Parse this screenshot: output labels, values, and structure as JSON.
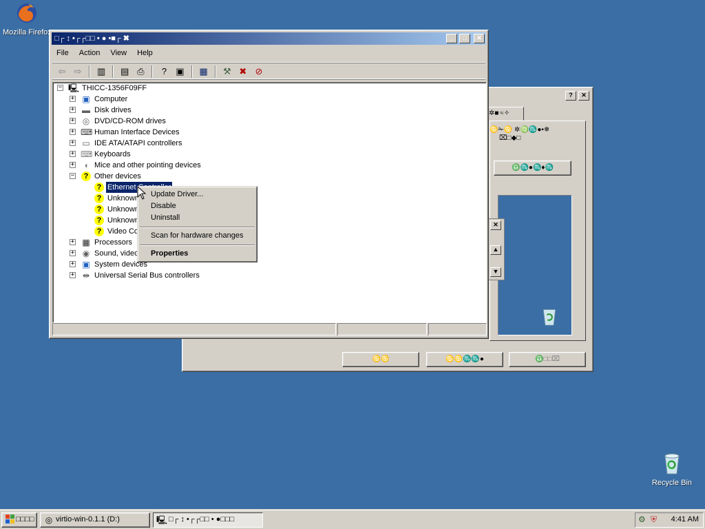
{
  "desktop": {
    "icons": [
      {
        "label": "Mozilla Firefox",
        "icon": "firefox-icon"
      },
      {
        "label": "Recycle Bin",
        "icon": "recycle-bin-icon"
      }
    ]
  },
  "background_dialog": {
    "title": "",
    "tab_label": "✲■♃✧",
    "row1": "♋✁♋ ✲♍♏●▪❄",
    "row2": "⌧□◆□",
    "button1": "♎♏●♏♦♏",
    "btn_ok": "♋♋",
    "btn_cancel": "♋♋♏♏●",
    "btn_apply": "♎□□⌧"
  },
  "device_manager": {
    "title": "□┌ ↕ •┌┌□□ • ● •■┌ ✖",
    "menu": [
      "File",
      "Action",
      "View",
      "Help"
    ],
    "tree": {
      "root": "THICC-1356F09FF",
      "categories": [
        {
          "label": "Computer",
          "icon": "computer-icon"
        },
        {
          "label": "Disk drives",
          "icon": "disk-drive-icon"
        },
        {
          "label": "DVD/CD-ROM drives",
          "icon": "cdrom-icon"
        },
        {
          "label": "Human Interface Devices",
          "icon": "hid-icon"
        },
        {
          "label": "IDE ATA/ATAPI controllers",
          "icon": "ide-icon"
        },
        {
          "label": "Keyboards",
          "icon": "keyboard-icon"
        },
        {
          "label": "Mice and other pointing devices",
          "icon": "mouse-icon"
        },
        {
          "label": "Other devices",
          "icon": "unknown-device-icon"
        }
      ],
      "other_devices": [
        "Ethernet Controller",
        "Unknown",
        "Unknown",
        "Unknown",
        "Video Co"
      ],
      "categories_after": [
        {
          "label": "Processors",
          "icon": "processor-icon"
        },
        {
          "label": "Sound, video",
          "icon": "sound-icon"
        },
        {
          "label": "System devices",
          "icon": "system-icon"
        },
        {
          "label": "Universal Serial Bus controllers",
          "icon": "usb-icon"
        }
      ]
    }
  },
  "context_menu": {
    "items": [
      "Update Driver...",
      "Disable",
      "Uninstall",
      "Scan for hardware changes",
      "Properties"
    ]
  },
  "taskbar": {
    "start_label": "□□□□",
    "tasks": [
      {
        "label": "virtio-win-0.1.1 (D:)",
        "active": false
      },
      {
        "label": "□┌ ↕ •┌┌□□ • ●□□□",
        "active": true
      }
    ],
    "clock": "4:41 AM"
  }
}
